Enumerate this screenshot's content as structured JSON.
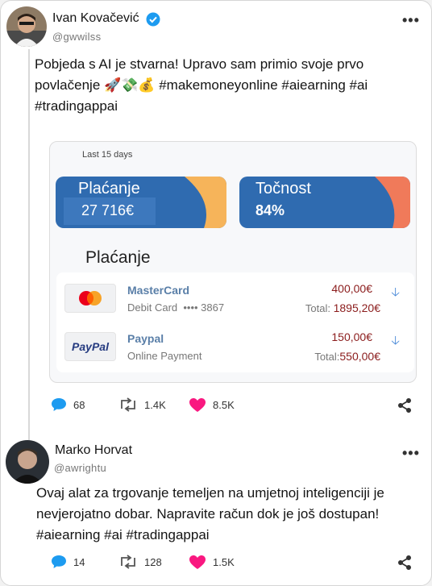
{
  "tweet1": {
    "name": "Ivan Kovačević",
    "handle": "@gwwilss",
    "text_line1": "Pobjeda s AI je stvarna! Upravo sam primio svoje prvo",
    "text_line2": "povlačenje 🚀💸💰 #makemoneyonline #aiearning #ai",
    "text_line3": "#tradingappai",
    "panel": {
      "subtitle": "Last 15 days",
      "stat1": {
        "label": "Plaćanje",
        "value": "27 716€",
        "color": "#2f6bb0",
        "accent": "#f6b45a"
      },
      "stat2": {
        "label": "Točnost",
        "value": "84%",
        "color": "#2f6bb0",
        "accent": "#f07a5a"
      },
      "section_title": "Plaćanje",
      "payments": [
        {
          "name": "MasterCard",
          "desc": "Debit Card  •••• 3867",
          "amount": "400,00€",
          "total_label": "Total:",
          "total": "1895,20€",
          "logo": "mastercard-logo"
        },
        {
          "name": "Paypal",
          "desc": "Online Payment",
          "amount": "150,00€",
          "total_label": "Total:",
          "total": "550,00€",
          "logo": "paypal-logo",
          "logo_text": "PayPal"
        }
      ]
    },
    "actions": {
      "replies": "68",
      "retweets": "1.4K",
      "likes": "8.5K"
    }
  },
  "tweet2": {
    "name": "Marko Horvat",
    "handle": "@awrightu",
    "text_line1": "Ovaj alat za trgovanje temeljen na umjetnoj inteligenciji je",
    "text_line2": "nevjerojatno dobar. Napravite račun dok je još dostupan!",
    "text_line3": "#aiearning #ai #tradingappai",
    "actions": {
      "replies": "14",
      "retweets": "128",
      "likes": "1.5K"
    }
  },
  "colors": {
    "verified": "#1d9bf0",
    "reply": "#1d9bf0",
    "like": "#f91880"
  },
  "menu_glyph": "•••"
}
